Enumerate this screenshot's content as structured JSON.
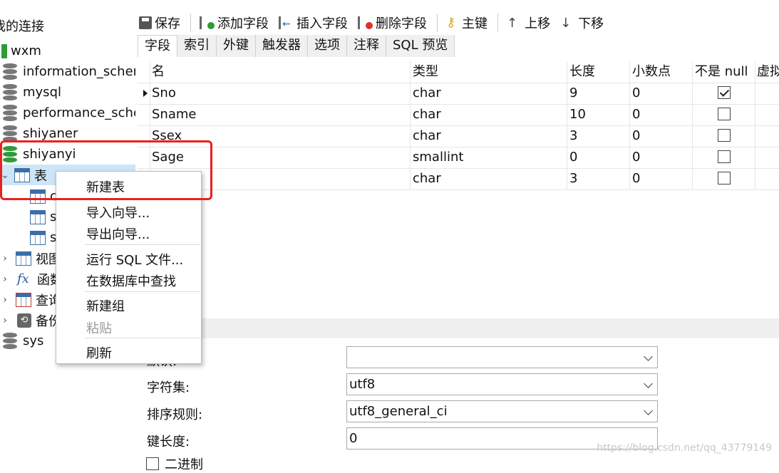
{
  "sidebar": {
    "header": "我的连接",
    "connection": "wxm",
    "databases": [
      "information_schema",
      "mysql",
      "performance_schema",
      "shiyaner",
      "shiyanyi"
    ],
    "tables_node": "表",
    "table_children": [
      "c",
      "s",
      "s"
    ],
    "other_nodes": [
      "视图",
      "函数",
      "查询",
      "备份"
    ],
    "last_db": "sys"
  },
  "toolbar": {
    "save": "保存",
    "add_field": "添加字段",
    "insert_field": "插入字段",
    "delete_field": "删除字段",
    "primary_key": "主键",
    "move_up": "上移",
    "move_down": "下移"
  },
  "tabs": [
    "字段",
    "索引",
    "外键",
    "触发器",
    "选项",
    "注释",
    "SQL 预览"
  ],
  "grid": {
    "columns": [
      "名",
      "类型",
      "长度",
      "小数点",
      "不是 null",
      "虚拟"
    ],
    "rows": [
      {
        "name": "Sno",
        "type": "char",
        "length": "9",
        "decimal": "0",
        "not_null": true
      },
      {
        "name": "Sname",
        "type": "char",
        "length": "10",
        "decimal": "0",
        "not_null": false
      },
      {
        "name": "Ssex",
        "type": "char",
        "length": "3",
        "decimal": "0",
        "not_null": false
      },
      {
        "name": "Sage",
        "type": "smallint",
        "length": "0",
        "decimal": "0",
        "not_null": false
      },
      {
        "name": "",
        "type": "char",
        "length": "3",
        "decimal": "0",
        "not_null": false
      }
    ]
  },
  "properties": {
    "charset_label": "字符集:",
    "charset_value": "utf8",
    "collation_label": "排序规则:",
    "collation_value": "utf8_general_ci",
    "key_length_label": "键长度:",
    "key_length_value": "0",
    "binary_label": "二进制",
    "default_label": "默认:",
    "default_value": ""
  },
  "context_menu": {
    "items": [
      "新建表",
      "导入向导...",
      "导出向导...",
      "运行 SQL 文件...",
      "在数据库中查找",
      "新建组",
      "粘贴",
      "刷新"
    ]
  },
  "watermark": "https://blog.csdn.net/qq_43779149",
  "colors": {
    "highlight": "#e8221c",
    "selection": "#cde6f7",
    "db_active": "#2e9b3a"
  }
}
